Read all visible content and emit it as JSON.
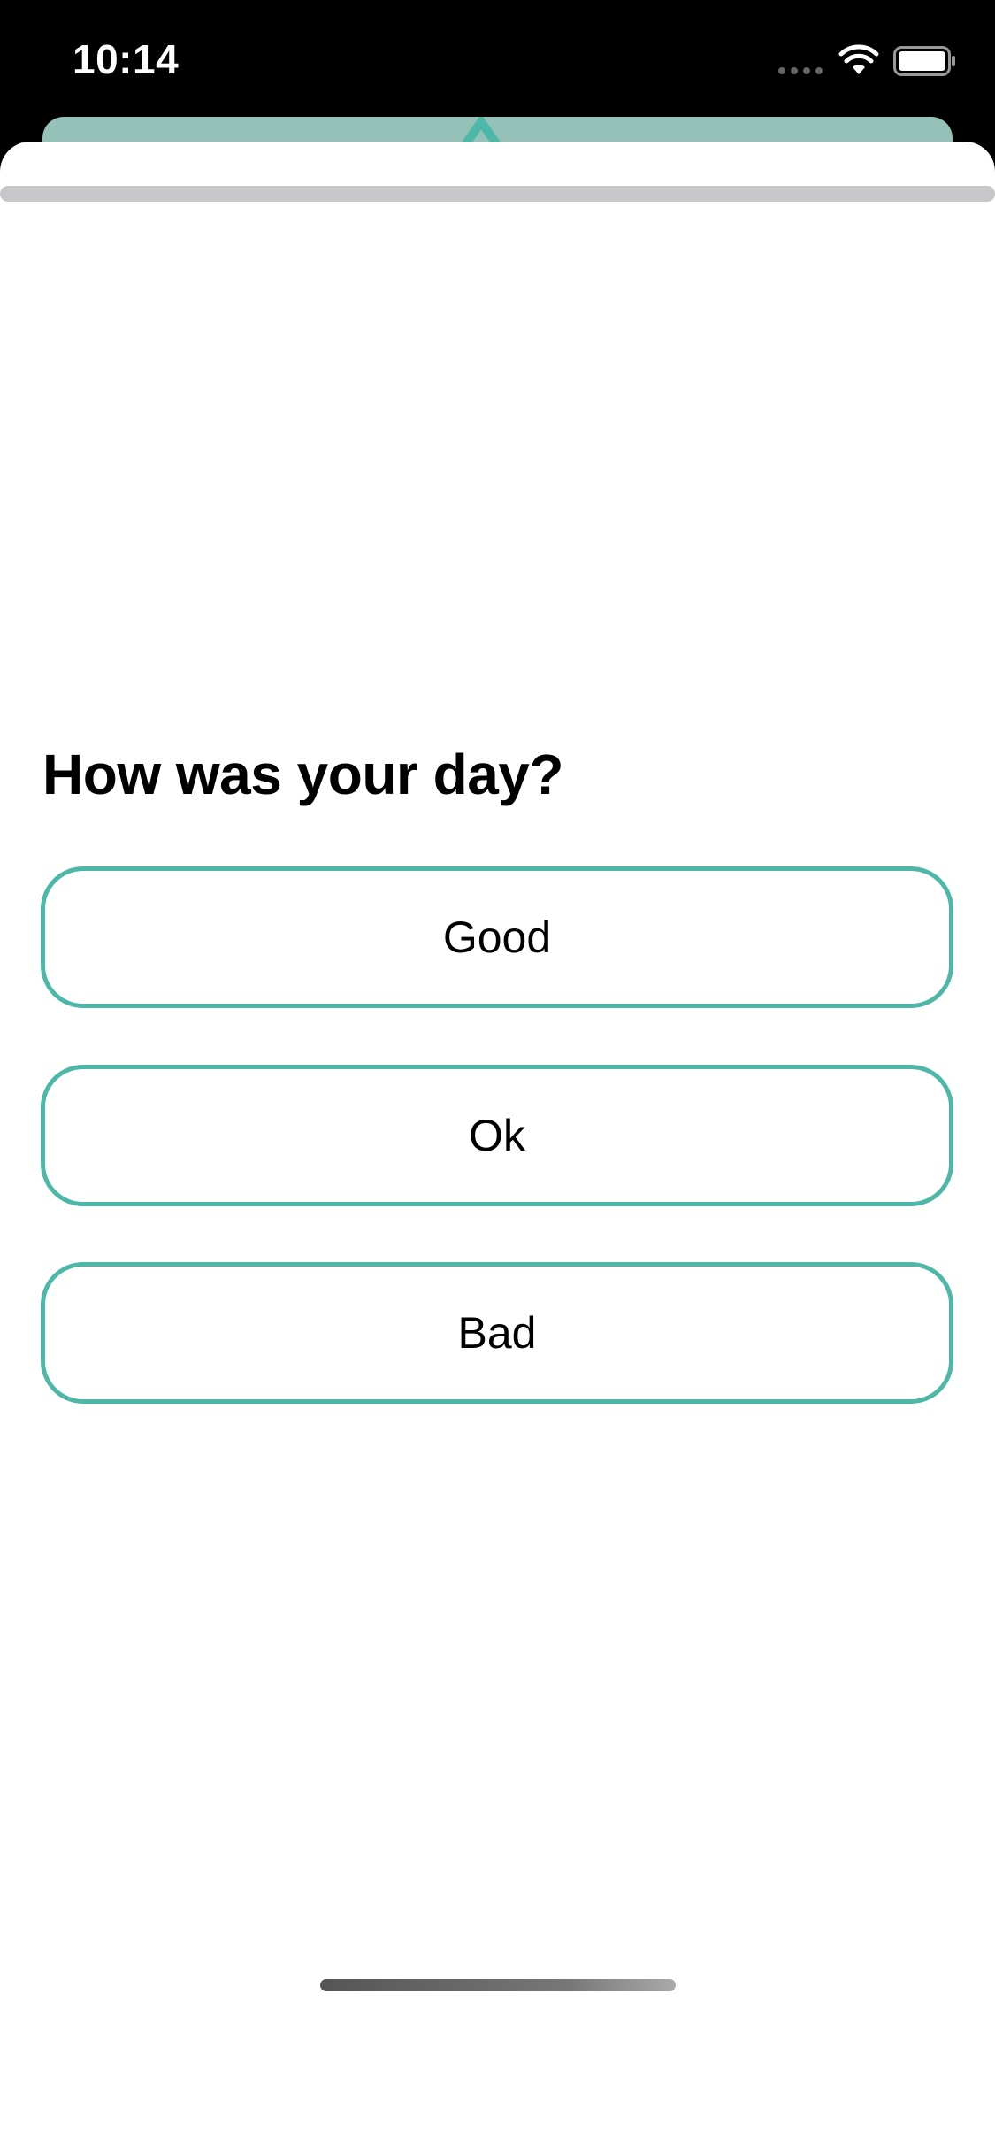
{
  "status_bar": {
    "time": "10:14",
    "icons": [
      "signal-icon",
      "wifi-icon",
      "battery-icon"
    ]
  },
  "theme": {
    "accent": "#4db8a8",
    "back_card": "#94c2b9",
    "background": "#ffffff",
    "status_bar_bg": "#000000"
  },
  "survey": {
    "question": "How was your day?",
    "options": [
      {
        "label": "Good"
      },
      {
        "label": "Ok"
      },
      {
        "label": "Bad"
      }
    ]
  }
}
